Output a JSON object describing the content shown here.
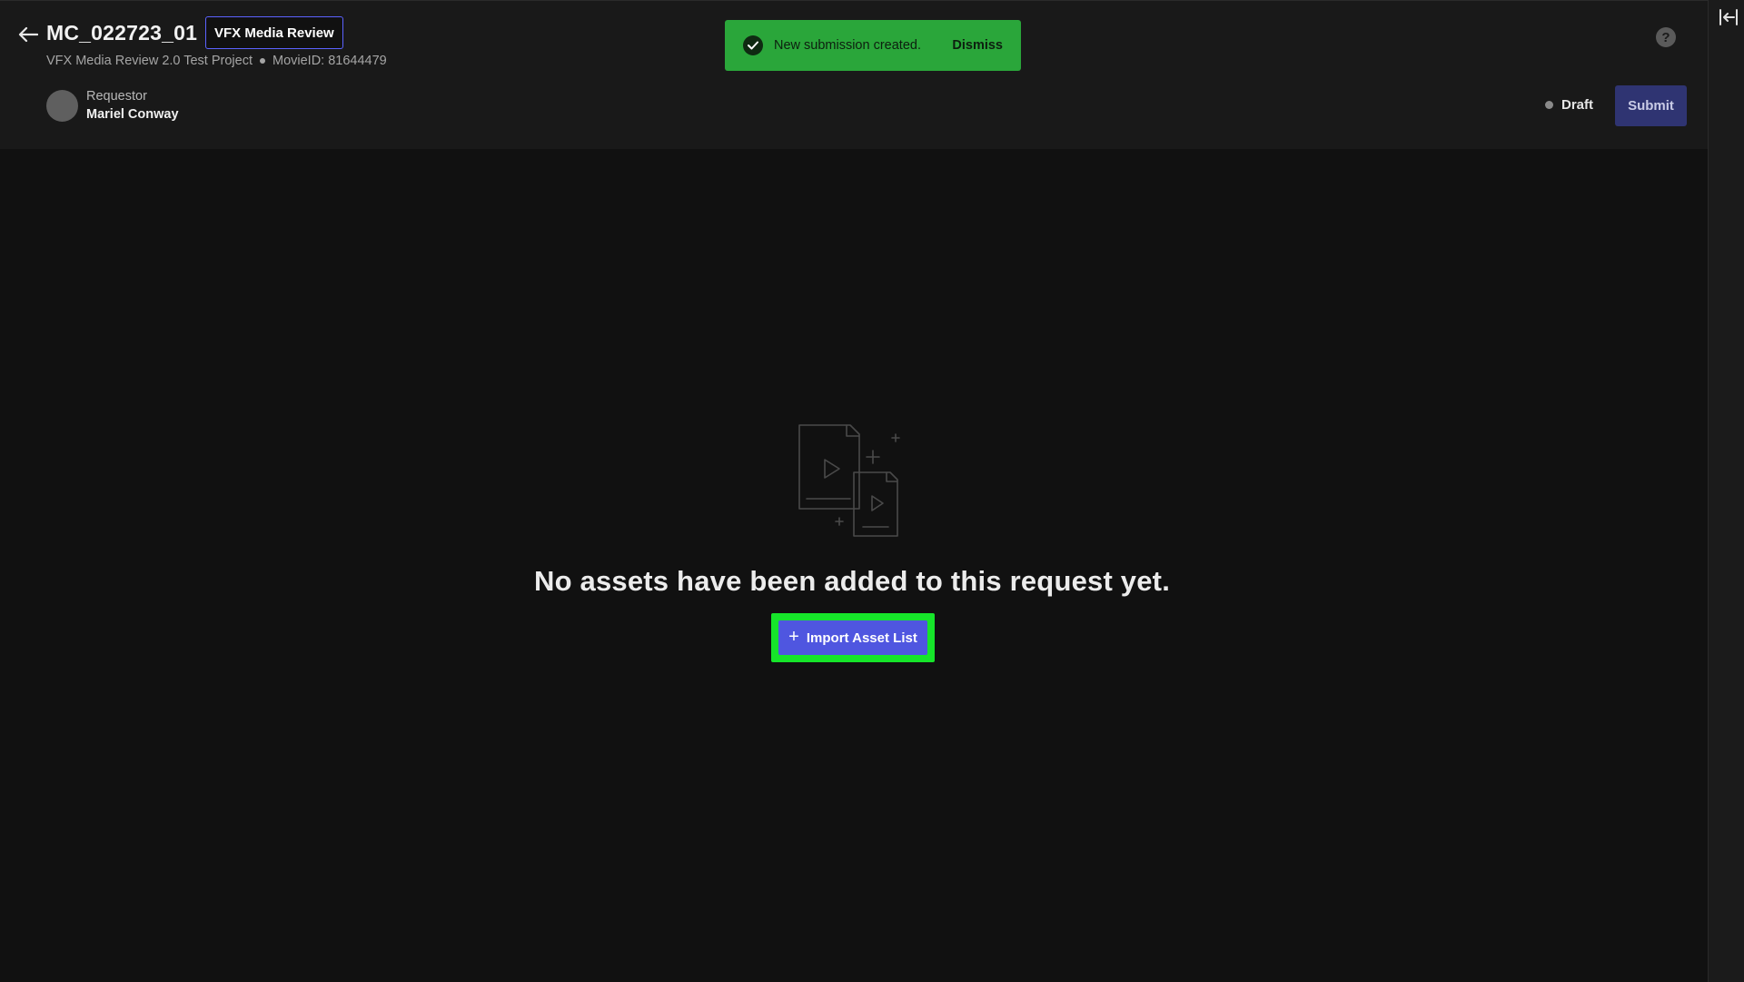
{
  "header": {
    "back_icon": "arrow-left-icon",
    "title": "MC_022723_01",
    "tag": "VFX Media Review",
    "project": "VFX Media Review 2.0 Test Project",
    "movie_id": "MovieID: 81644479",
    "requestor_label": "Requestor",
    "requestor_name": "Mariel Conway"
  },
  "toast": {
    "message": "New submission created.",
    "dismiss_label": "Dismiss",
    "icon": "check-circle-icon",
    "color": "#2aa63a"
  },
  "actions": {
    "help_icon": "question-circle-icon",
    "help_glyph": "?",
    "status_label": "Draft",
    "submit_label": "Submit"
  },
  "right_rail": {
    "icon": "collapse-panel-icon"
  },
  "empty_state": {
    "illustration": "media-files-illustration",
    "message": "No assets have been added to this request yet.",
    "import_label": "Import Asset List",
    "import_icon": "plus-icon",
    "accent": "#4f56e0"
  }
}
